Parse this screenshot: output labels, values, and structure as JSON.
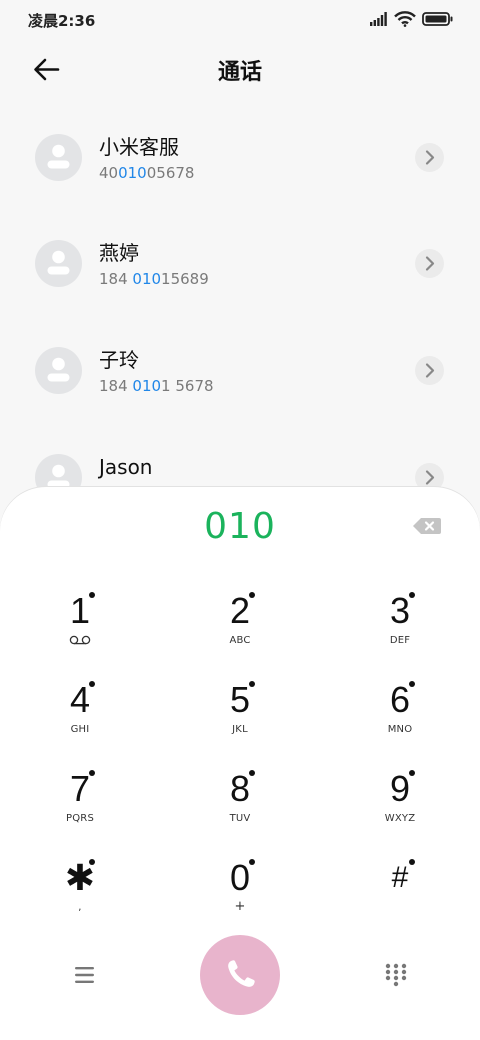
{
  "status_bar": {
    "time": "凌晨2:36",
    "icons": [
      "signal-icon",
      "wifi-icon",
      "battery-icon"
    ]
  },
  "header": {
    "title": "通话",
    "back_icon": "arrow-left-icon"
  },
  "contacts": [
    {
      "name": "小米客服",
      "number_parts": [
        "40",
        "010",
        "05678"
      ]
    },
    {
      "name": "燕婷",
      "number_parts": [
        "184 ",
        "010",
        "15689"
      ]
    },
    {
      "name": "子玲",
      "number_parts": [
        "184 ",
        "010",
        "1 5678"
      ]
    },
    {
      "name": "Jason",
      "number_parts": [
        "",
        "",
        ""
      ]
    }
  ],
  "dialpad": {
    "entered_number": "010",
    "keys": [
      {
        "digit": "1",
        "sub": "voicemail-icon"
      },
      {
        "digit": "2",
        "sub": "ABC"
      },
      {
        "digit": "3",
        "sub": "DEF"
      },
      {
        "digit": "4",
        "sub": "GHI"
      },
      {
        "digit": "5",
        "sub": "JKL"
      },
      {
        "digit": "6",
        "sub": "MNO"
      },
      {
        "digit": "7",
        "sub": "PQRS"
      },
      {
        "digit": "8",
        "sub": "TUV"
      },
      {
        "digit": "9",
        "sub": "WXYZ"
      },
      {
        "digit": "✱",
        "sub": ","
      },
      {
        "digit": "0",
        "sub": "+"
      },
      {
        "digit": "#",
        "sub": ""
      }
    ]
  },
  "colors": {
    "accent_green": "#1bb35c",
    "highlight_blue": "#2187e8",
    "call_button": "#e8b4cc"
  }
}
